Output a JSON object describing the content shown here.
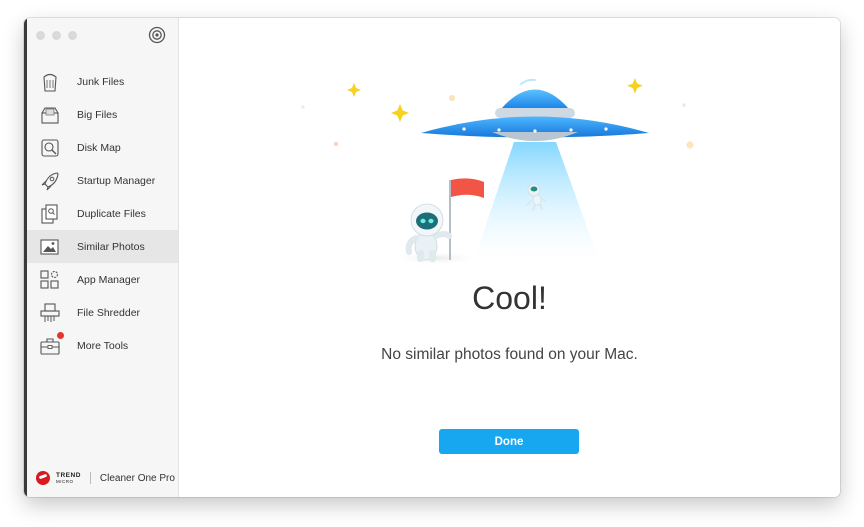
{
  "sidebar": {
    "items": [
      {
        "label": "Junk Files",
        "icon": "trash-can-icon"
      },
      {
        "label": "Big Files",
        "icon": "big-files-icon"
      },
      {
        "label": "Disk Map",
        "icon": "disk-map-icon"
      },
      {
        "label": "Startup Manager",
        "icon": "rocket-icon"
      },
      {
        "label": "Duplicate Files",
        "icon": "duplicate-files-icon"
      },
      {
        "label": "Similar Photos",
        "icon": "photo-icon",
        "active": true
      },
      {
        "label": "App Manager",
        "icon": "app-manager-icon"
      },
      {
        "label": "File Shredder",
        "icon": "shredder-icon"
      },
      {
        "label": "More Tools",
        "icon": "toolbox-icon",
        "badge": true
      }
    ],
    "brand": {
      "logo_text": "TREND",
      "logo_subtext": "MICRO",
      "product": "Cleaner One Pro"
    }
  },
  "main": {
    "title": "Cool!",
    "message": "No similar photos found on your Mac.",
    "done_label": "Done"
  },
  "colors": {
    "accent": "#16a7f0",
    "badge": "#e8322f",
    "flag": "#f25446"
  }
}
